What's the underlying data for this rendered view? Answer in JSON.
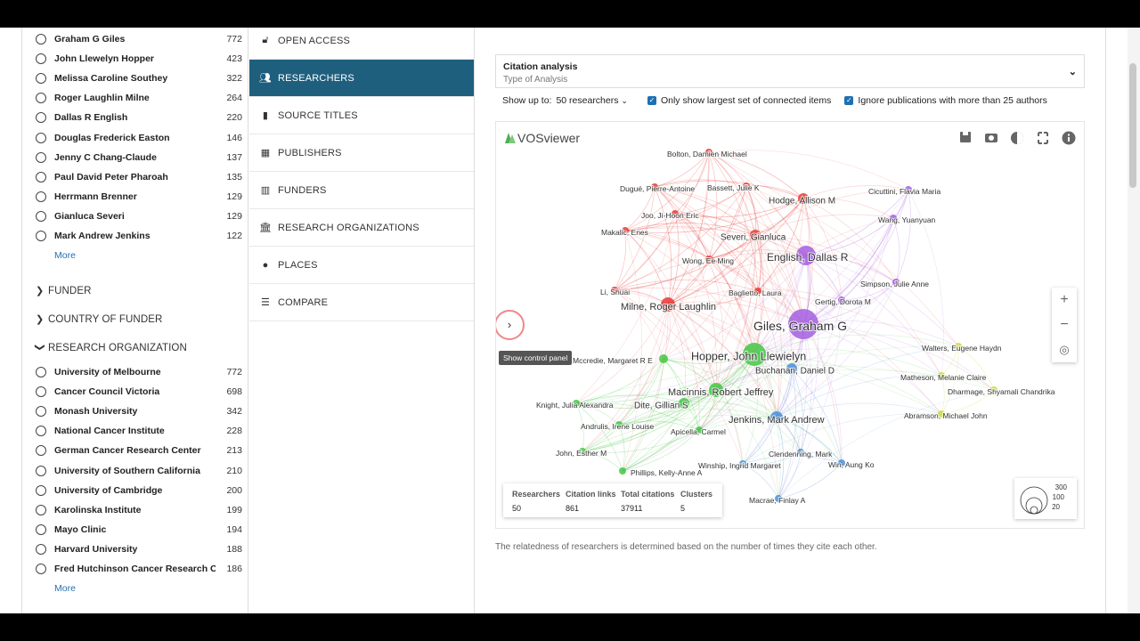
{
  "researchers": [
    {
      "name": "Graham G Giles",
      "count": "772"
    },
    {
      "name": "John Llewelyn Hopper",
      "count": "423"
    },
    {
      "name": "Melissa Caroline Southey",
      "count": "322"
    },
    {
      "name": "Roger Laughlin Milne",
      "count": "264"
    },
    {
      "name": "Dallas R English",
      "count": "220"
    },
    {
      "name": "Douglas Frederick Easton",
      "count": "146"
    },
    {
      "name": "Jenny C Chang-Claude",
      "count": "137"
    },
    {
      "name": "Paul David Peter Pharoah",
      "count": "135"
    },
    {
      "name": "Herrmann Brenner",
      "count": "129"
    },
    {
      "name": "Gianluca Severi",
      "count": "129"
    },
    {
      "name": "Mark Andrew Jenkins",
      "count": "122"
    }
  ],
  "more_label": "More",
  "sections": {
    "funder": "FUNDER",
    "country_of_funder": "COUNTRY OF FUNDER",
    "research_organization": "RESEARCH ORGANIZATION"
  },
  "organizations": [
    {
      "name": "University of Melbourne",
      "count": "772"
    },
    {
      "name": "Cancer Council Victoria",
      "count": "698"
    },
    {
      "name": "Monash University",
      "count": "342"
    },
    {
      "name": "National Cancer Institute",
      "count": "228"
    },
    {
      "name": "German Cancer Research Center",
      "count": "213"
    },
    {
      "name": "University of Southern California",
      "count": "210"
    },
    {
      "name": "University of Cambridge",
      "count": "200"
    },
    {
      "name": "Karolinska Institute",
      "count": "199"
    },
    {
      "name": "Mayo Clinic",
      "count": "194"
    },
    {
      "name": "Harvard University",
      "count": "188"
    },
    {
      "name": "Fred Hutchinson Cancer Research Center",
      "count": "186"
    }
  ],
  "nav": [
    {
      "label": "OPEN ACCESS",
      "icon": "lock-icon"
    },
    {
      "label": "RESEARCHERS",
      "icon": "people-icon",
      "active": true
    },
    {
      "label": "SOURCE TITLES",
      "icon": "book-icon"
    },
    {
      "label": "PUBLISHERS",
      "icon": "publisher-icon"
    },
    {
      "label": "FUNDERS",
      "icon": "building-icon"
    },
    {
      "label": "RESEARCH ORGANIZATIONS",
      "icon": "institution-icon"
    },
    {
      "label": "PLACES",
      "icon": "place-icon"
    },
    {
      "label": "COMPARE",
      "icon": "compare-icon"
    }
  ],
  "analysis": {
    "title": "Citation analysis",
    "subtitle": "Type of Analysis"
  },
  "options": {
    "show_up_to_label": "Show up to:",
    "show_up_to_value": "50 researchers",
    "largest_set": "Only show largest set of connected items",
    "ignore_pubs": "Ignore publications with more than 25 authors"
  },
  "viz": {
    "brand": "VOSviewer",
    "tooltip": "Show control panel",
    "stats_headers": [
      "Researchers",
      "Citation links",
      "Total citations",
      "Clusters"
    ],
    "stats_values": [
      "50",
      "861",
      "37911",
      "5"
    ],
    "size_legend": [
      "300",
      "100",
      "20"
    ]
  },
  "footnote": "The relatedness of researchers is determined based on the number of times they cite each other.",
  "colors": {
    "accent": "#1f5f7e",
    "red": "#e53935",
    "green": "#43c743",
    "blue": "#4a90d9",
    "purple": "#a55ee0",
    "yellow": "#cddc39"
  },
  "network": [
    {
      "label": "Bolton, Damien Michael",
      "c": "red"
    },
    {
      "label": "Dugué, Pierre-Antoine",
      "c": "red"
    },
    {
      "label": "Bassett, Julie K",
      "c": "red"
    },
    {
      "label": "Hodge, Allison M",
      "c": "red"
    },
    {
      "label": "Joo, Ji-Hoon Eric",
      "c": "red"
    },
    {
      "label": "Makalic, Enes",
      "c": "red"
    },
    {
      "label": "Severi, Gianluca",
      "c": "red"
    },
    {
      "label": "Wong, Ee Ming",
      "c": "red"
    },
    {
      "label": "Li, Shuai",
      "c": "red"
    },
    {
      "label": "Baglietto, Laura",
      "c": "red"
    },
    {
      "label": "Milne, Roger Laughlin",
      "c": "red"
    },
    {
      "label": "Cicuttini, Flavia Maria",
      "c": "purple"
    },
    {
      "label": "Wang, Yuanyuan",
      "c": "purple"
    },
    {
      "label": "English, Dallas R",
      "c": "purple"
    },
    {
      "label": "Simpson, Julie Anne",
      "c": "purple"
    },
    {
      "label": "Gertig, Dorota M",
      "c": "purple"
    },
    {
      "label": "Giles, Graham G",
      "c": "purple"
    },
    {
      "label": "Hopper, John Llewielyn",
      "c": "green"
    },
    {
      "label": "Mccredie, Margaret R E",
      "c": "green"
    },
    {
      "label": "Macinnis, Robert Jeffrey",
      "c": "green"
    },
    {
      "label": "Knight, Julia Alexandra",
      "c": "green"
    },
    {
      "label": "Dite, Gillian S",
      "c": "green"
    },
    {
      "label": "Andrulis, Irene Louise",
      "c": "green"
    },
    {
      "label": "Apicella, Carmel",
      "c": "green"
    },
    {
      "label": "John, Esther M",
      "c": "green"
    },
    {
      "label": "Phillips, Kelly-Anne A",
      "c": "green"
    },
    {
      "label": "Buchanan, Daniel D",
      "c": "blue"
    },
    {
      "label": "Jenkins, Mark Andrew",
      "c": "blue"
    },
    {
      "label": "Clendenning, Mark",
      "c": "blue"
    },
    {
      "label": "Winship, Ingrid Margaret",
      "c": "blue"
    },
    {
      "label": "Win, Aung Ko",
      "c": "blue"
    },
    {
      "label": "Macrae, Finlay A",
      "c": "blue"
    },
    {
      "label": "Walters, Eugene Haydn",
      "c": "yellow"
    },
    {
      "label": "Matheson, Melanie Claire",
      "c": "yellow"
    },
    {
      "label": "Dharmage, Shyamali Chandrika",
      "c": "yellow"
    },
    {
      "label": "Abramson, Michael John",
      "c": "yellow"
    }
  ]
}
